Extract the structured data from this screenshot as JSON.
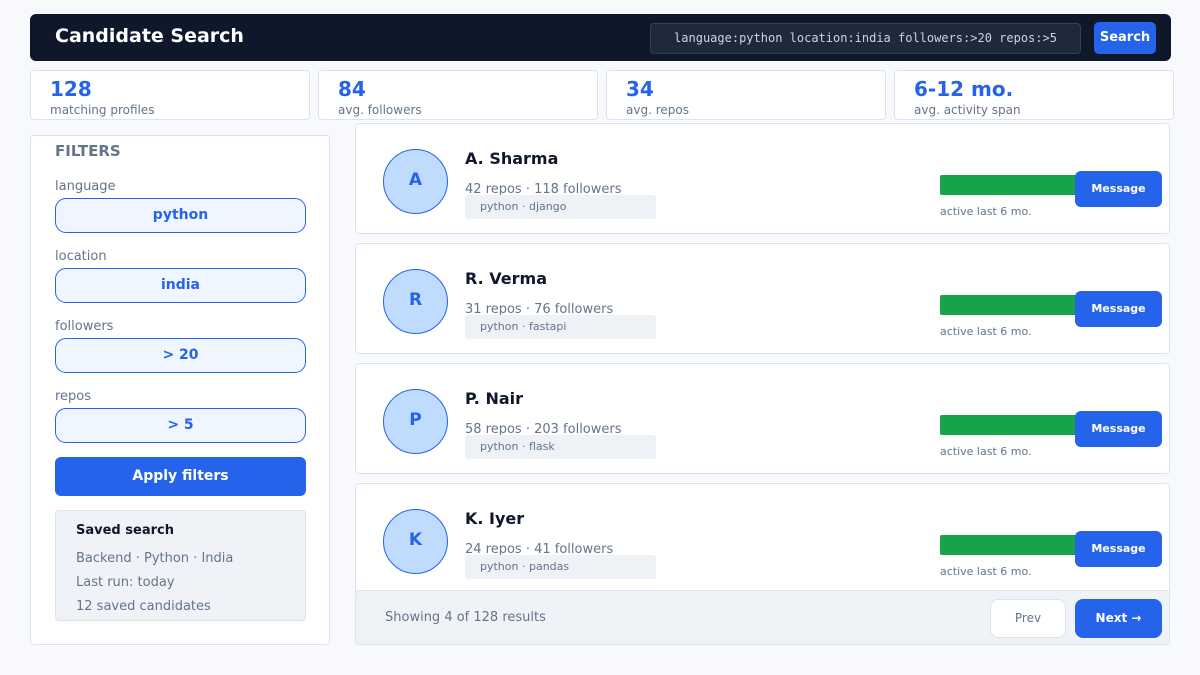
{
  "header": {
    "title": "Candidate Search",
    "query": "language:python location:india followers:>20 repos:>5",
    "search_label": "Search"
  },
  "stats": [
    {
      "value": "128",
      "label": "matching profiles"
    },
    {
      "value": "84",
      "label": "avg. followers"
    },
    {
      "value": "34",
      "label": "avg. repos"
    },
    {
      "value": "6-12 mo.",
      "label": "avg. activity span"
    }
  ],
  "filters": {
    "heading": "FILTERS",
    "fields": [
      {
        "label": "language",
        "value": "python"
      },
      {
        "label": "location",
        "value": "india"
      },
      {
        "label": "followers",
        "value": "> 20"
      },
      {
        "label": "repos",
        "value": "> 5"
      }
    ],
    "apply_label": "Apply filters",
    "saved": {
      "title": "Saved search",
      "lines": [
        "Backend · Python · India",
        "Last run: today",
        "12 saved candidates"
      ]
    }
  },
  "candidates": [
    {
      "initial": "A",
      "name": "A. Sharma",
      "meta": "42 repos · 118 followers",
      "tags": "python · django",
      "activity_level": 1.0,
      "activity": "active last 6 mo.",
      "message_label": "Message"
    },
    {
      "initial": "R",
      "name": "R. Verma",
      "meta": "31 repos · 76 followers",
      "tags": "python · fastapi",
      "activity_level": 1.0,
      "activity": "active last 6 mo.",
      "message_label": "Message"
    },
    {
      "initial": "P",
      "name": "P. Nair",
      "meta": "58 repos · 203 followers",
      "tags": "python · flask",
      "activity_level": 1.0,
      "activity": "active last 6 mo.",
      "message_label": "Message"
    },
    {
      "initial": "K",
      "name": "K. Iyer",
      "meta": "24 repos · 41 followers",
      "tags": "python · pandas",
      "activity_level": 1.0,
      "activity": "active last 6 mo.",
      "message_label": "Message"
    }
  ],
  "footer": {
    "showing": "Showing 4 of 128 results",
    "prev_label": "Prev",
    "next_label": "Next →"
  },
  "colors": {
    "accent": "#2563eb",
    "activity": "#16a34a",
    "header_bg": "#0f172a"
  }
}
